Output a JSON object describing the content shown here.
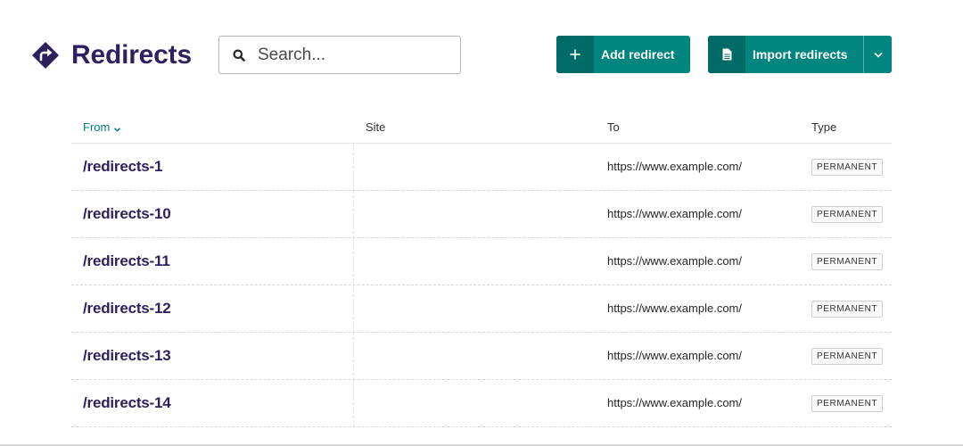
{
  "header": {
    "title": "Redirects",
    "title_icon": "redirect-icon",
    "search": {
      "placeholder": "Search...",
      "value": ""
    },
    "add_button": {
      "label": "Add redirect",
      "icon": "plus-icon"
    },
    "import_button": {
      "label": "Import redirects",
      "icon": "document-icon",
      "dropdown_icon": "chevron-down-icon"
    }
  },
  "table": {
    "columns": [
      {
        "label": "From",
        "sorted": true
      },
      {
        "label": "Site"
      },
      {
        "label": "To"
      },
      {
        "label": "Type"
      }
    ],
    "rows": [
      {
        "from": "/redirects-1",
        "site": "",
        "to": "https://www.example.com/",
        "type": "PERMANENT"
      },
      {
        "from": "/redirects-10",
        "site": "",
        "to": "https://www.example.com/",
        "type": "PERMANENT"
      },
      {
        "from": "/redirects-11",
        "site": "",
        "to": "https://www.example.com/",
        "type": "PERMANENT"
      },
      {
        "from": "/redirects-12",
        "site": "",
        "to": "https://www.example.com/",
        "type": "PERMANENT"
      },
      {
        "from": "/redirects-13",
        "site": "",
        "to": "https://www.example.com/",
        "type": "PERMANENT"
      },
      {
        "from": "/redirects-14",
        "site": "",
        "to": "https://www.example.com/",
        "type": "PERMANENT"
      }
    ]
  },
  "colors": {
    "brand": "#2e1f5e",
    "accent": "#00857f",
    "accent_dark": "#006b66",
    "sort_link": "#007d78"
  }
}
